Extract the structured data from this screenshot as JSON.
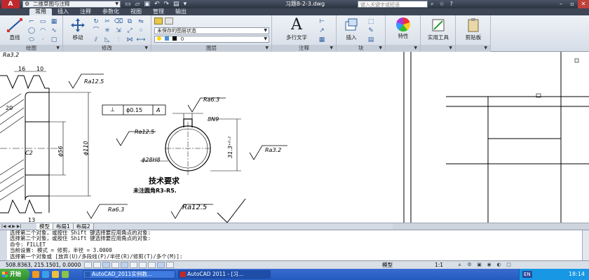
{
  "titlebar": {
    "workspace": "二维草图与注释",
    "title": "习题8-2-3.dwg",
    "search_placeholder": "键入关键字或短语"
  },
  "tabs": [
    "常用",
    "插入",
    "注释",
    "参数化",
    "视图",
    "管理",
    "输出"
  ],
  "ribbon": {
    "draw": {
      "label": "绘图",
      "line": "直线"
    },
    "modify": {
      "label": "修改",
      "move": "移动"
    },
    "layers": {
      "label": "图层",
      "state": "未保存的图层状态",
      "layer": "0"
    },
    "annotation": {
      "label": "注释",
      "mtext": "多行文字"
    },
    "block": {
      "label": "块",
      "insert": "插入"
    },
    "properties": {
      "label": "特性"
    },
    "utilities": {
      "label": "实用工具"
    },
    "clipboard": {
      "label": "剪贴板"
    }
  },
  "drawing": {
    "top_label": "Ra3.2",
    "dims": {
      "d16": "16",
      "d10": "10",
      "d20": "20",
      "phi56": "ϕ56",
      "phi110": "ϕ110",
      "c2": "C2",
      "d13": "13",
      "keyway_width": "8N9",
      "keyway_depth": "31.3⁺⁰·²",
      "bore": "ϕ28H8"
    },
    "roughness": [
      "Ra12.5",
      "Ra6.3",
      "Ra12.5",
      "Ra3.2",
      "Ra6.3",
      "Ra12.5"
    ],
    "tolerance": {
      "symbol": "⊥",
      "value": "ϕ0.15",
      "datum": "A"
    },
    "tech_title": "技术要求",
    "tech_note": "未注圆角R3-R5."
  },
  "layout_tabs": [
    "模型",
    "布局1",
    "布局2"
  ],
  "command_lines": [
    "选择第二个对象，或按住 Shift 键选择要应用角点的对象:",
    "选择第二个对象，或按住 Shift 键选择要应用角点的对象:",
    "命令:  FILLET",
    "当前设置: 模式 = 修剪，半径 = 3.0000",
    "选择第一个对象或 [放弃(U)/多段线(P)/半径(R)/修剪(T)/多个(M)]:"
  ],
  "status": {
    "coords": "508.8363, 215.1501, 0.0000",
    "model": "模型",
    "scale": "1:1"
  },
  "taskbar": {
    "start": "开始",
    "tasks": [
      "AutoCAD_2011实例教...",
      "AutoCAD 2011 - [习..."
    ],
    "lang": "EN",
    "clock": "18:14"
  },
  "colors": {
    "ribbon_bg": "#dfe6ef",
    "title_bg": "#2b3340",
    "taskbar": "#245bbf"
  }
}
